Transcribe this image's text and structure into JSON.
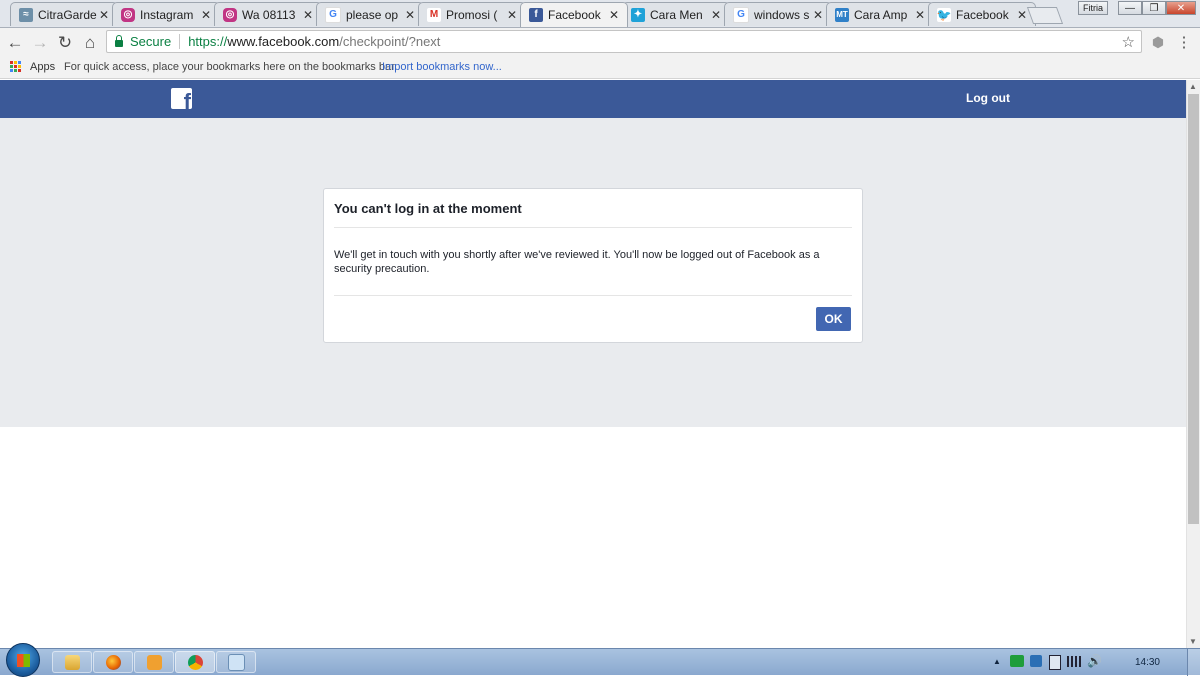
{
  "browser": {
    "tabs": [
      {
        "title": "CitraGarde",
        "favicon": "citragarden-icon",
        "color": "#6d8fa8"
      },
      {
        "title": "Instagram",
        "favicon": "instagram-icon",
        "color": "#c13584"
      },
      {
        "title": "Wa 08113",
        "favicon": "instagram-icon",
        "color": "#c13584"
      },
      {
        "title": "please op",
        "favicon": "google-icon",
        "color": "#4285f4"
      },
      {
        "title": "Promosi (",
        "favicon": "gmail-icon",
        "color": "#d93025"
      },
      {
        "title": "Facebook",
        "favicon": "facebook-icon",
        "color": "#3b5998",
        "active": true
      },
      {
        "title": "Cara Men",
        "favicon": "cara-icon",
        "color": "#1fa2d8"
      },
      {
        "title": "windows s",
        "favicon": "google-icon",
        "color": "#4285f4"
      },
      {
        "title": "Cara Amp",
        "favicon": "mt-icon",
        "color": "#2f80c8"
      },
      {
        "title": "Facebook",
        "favicon": "twitter-icon",
        "color": "#1da1f2"
      }
    ],
    "close_glyph": "✕",
    "user_profile": "Fitria",
    "window_controls": {
      "minimize": "—",
      "restore": "❐",
      "close": "✕"
    },
    "address": {
      "secure_label": "Secure",
      "scheme": "https://",
      "host": "www.facebook.com",
      "path": "/checkpoint/?next"
    },
    "bookmarks": {
      "apps_label": "Apps",
      "hint": "For quick access, place your bookmarks here on the bookmarks bar.",
      "import_link": "Import bookmarks now..."
    }
  },
  "page": {
    "header": {
      "logo": "f",
      "logout": "Log out"
    },
    "dialog": {
      "title": "You can't log in at the moment",
      "message": "We'll get in touch with you shortly after we've reviewed it. You'll now be logged out of Facebook as a security precaution.",
      "ok": "OK"
    }
  },
  "taskbar": {
    "apps": [
      "explorer-icon",
      "firefox-icon",
      "media-player-icon",
      "chrome-icon",
      "notepad-icon"
    ],
    "clock": "14:30",
    "tray_arrow": "▲"
  },
  "colors": {
    "facebook_blue": "#3b5998",
    "button_blue": "#4267b2",
    "page_gray": "#e9ebee",
    "secure_green": "#0b8043"
  }
}
